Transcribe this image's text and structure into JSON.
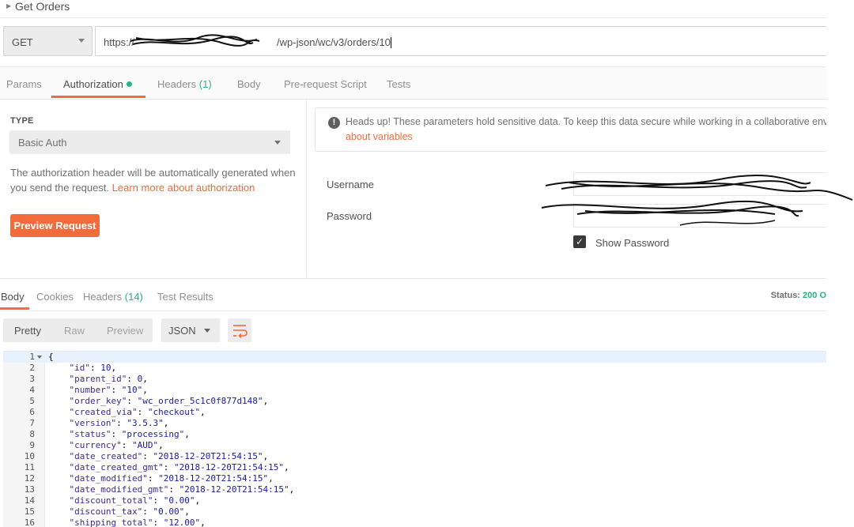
{
  "request": {
    "name": "Get Orders",
    "method": "GET",
    "url": "https://[redacted]/wp-json/wc/v3/orders/10",
    "url_prefix": "https://",
    "url_suffix": "/wp-json/wc/v3/orders/10"
  },
  "request_tabs": [
    {
      "label": "Params"
    },
    {
      "label": "Authorization",
      "active": true,
      "indicator": "green-dot"
    },
    {
      "label": "Headers",
      "count": "(1)"
    },
    {
      "label": "Body"
    },
    {
      "label": "Pre-request Script"
    },
    {
      "label": "Tests"
    }
  ],
  "auth": {
    "type_label": "TYPE",
    "type_value": "Basic Auth",
    "description": "The authorization header will be automatically generated when you send the request.",
    "learn_more": "Learn more about authorization",
    "preview_button": "Preview Request",
    "warning_text": "Heads up! These parameters hold sensitive data. To keep this data secure while working in a collaborative env",
    "warning_link": "about variables",
    "username_label": "Username",
    "password_label": "Password",
    "show_password_label": "Show Password",
    "show_password_checked": true
  },
  "response_tabs": [
    {
      "label": "Body",
      "active": true
    },
    {
      "label": "Cookies"
    },
    {
      "label": "Headers",
      "count": "(14)"
    },
    {
      "label": "Test Results"
    }
  ],
  "status": {
    "label": "Status:",
    "value": "200 O"
  },
  "view_modes": [
    "Pretty",
    "Raw",
    "Preview"
  ],
  "format": "JSON",
  "code_lines": [
    {
      "n": "1",
      "text": "{"
    },
    {
      "n": "2",
      "key": "id",
      "val": "10",
      "type": "num"
    },
    {
      "n": "3",
      "key": "parent_id",
      "val": "0",
      "type": "num"
    },
    {
      "n": "4",
      "key": "number",
      "val": "\"10\"",
      "type": "str"
    },
    {
      "n": "5",
      "key": "order_key",
      "val": "\"wc_order_5c1c0f877d148\"",
      "type": "str"
    },
    {
      "n": "6",
      "key": "created_via",
      "val": "\"checkout\"",
      "type": "str"
    },
    {
      "n": "7",
      "key": "version",
      "val": "\"3.5.3\"",
      "type": "str"
    },
    {
      "n": "8",
      "key": "status",
      "val": "\"processing\"",
      "type": "str"
    },
    {
      "n": "9",
      "key": "currency",
      "val": "\"AUD\"",
      "type": "str"
    },
    {
      "n": "10",
      "key": "date_created",
      "val": "\"2018-12-20T21:54:15\"",
      "type": "str"
    },
    {
      "n": "11",
      "key": "date_created_gmt",
      "val": "\"2018-12-20T21:54:15\"",
      "type": "str"
    },
    {
      "n": "12",
      "key": "date_modified",
      "val": "\"2018-12-20T21:54:15\"",
      "type": "str"
    },
    {
      "n": "13",
      "key": "date_modified_gmt",
      "val": "\"2018-12-20T21:54:15\"",
      "type": "str"
    },
    {
      "n": "14",
      "key": "discount_total",
      "val": "\"0.00\"",
      "type": "str"
    },
    {
      "n": "15",
      "key": "discount_tax",
      "val": "\"0.00\"",
      "type": "str"
    },
    {
      "n": "16",
      "key": "shipping_total",
      "val": "\"12.00\"",
      "type": "str"
    }
  ],
  "colors": {
    "accent": "#f26b3a",
    "success": "#26b47f"
  }
}
